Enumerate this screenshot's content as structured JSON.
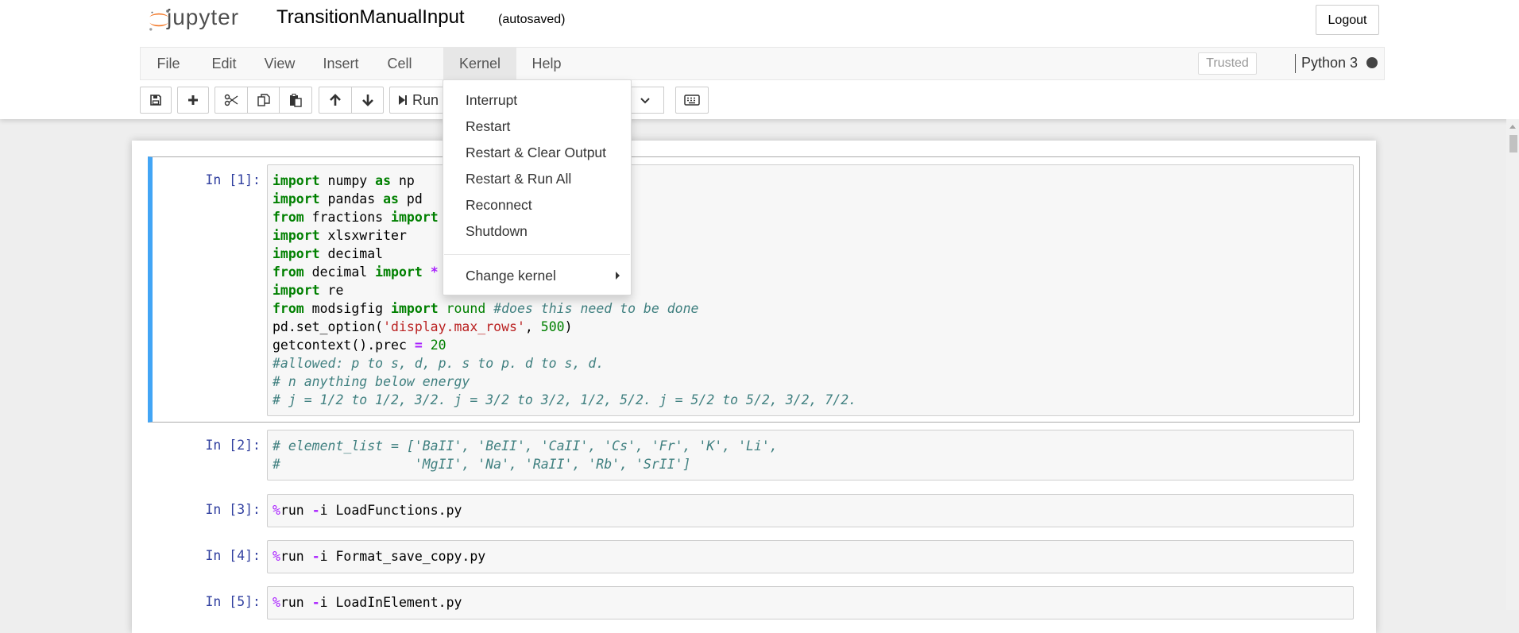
{
  "header": {
    "logo_text": "jupyter",
    "notebook_title": "TransitionManualInput",
    "autosave_status": "(autosaved)",
    "logout_label": "Logout"
  },
  "menubar": {
    "items": [
      "File",
      "Edit",
      "View",
      "Insert",
      "Cell",
      "Kernel",
      "Help"
    ],
    "active": "Kernel",
    "trusted_label": "Trusted",
    "kernel_name": "Python 3"
  },
  "toolbar": {
    "run_label": "Run",
    "buttons": [
      "save-icon",
      "plus-icon",
      "cut-icon",
      "copy-icon",
      "paste-icon",
      "arrow-up-icon",
      "arrow-down-icon",
      "run-icon",
      "chevron-down-icon",
      "keyboard-icon"
    ]
  },
  "kernel_menu": {
    "items": [
      "Interrupt",
      "Restart",
      "Restart & Clear Output",
      "Restart & Run All",
      "Reconnect",
      "Shutdown"
    ],
    "change_kernel": "Change kernel"
  },
  "cells": [
    {
      "prompt": "In [1]:",
      "lines": [
        "import numpy as np",
        "import pandas as pd",
        "from fractions import",
        "import xlsxwriter",
        "import decimal",
        "from decimal import *",
        "import re",
        "from modsigfig import round #does this need to be done",
        "pd.set_option('display.max_rows', 500)",
        "getcontext().prec = 20",
        "#allowed: p to s, d, p. s to p. d to s, d.",
        "# n anything below energy",
        "# j = 1/2 to 1/2, 3/2. j = 3/2 to 3/2, 1/2, 5/2. j = 5/2 to 5/2, 3/2, 7/2."
      ]
    },
    {
      "prompt": "In [2]:",
      "lines": [
        "# element_list = ['BaII', 'BeII', 'CaII', 'Cs', 'Fr', 'K', 'Li',",
        "#                 'MgII', 'Na', 'RaII', 'Rb', 'SrII']"
      ]
    },
    {
      "prompt": "In [3]:",
      "lines": [
        "%run -i LoadFunctions.py"
      ]
    },
    {
      "prompt": "In [4]:",
      "lines": [
        "%run -i Format_save_copy.py"
      ]
    },
    {
      "prompt": "In [5]:",
      "lines": [
        "%run -i LoadInElement.py"
      ]
    }
  ],
  "colors": {
    "accent_selected_cell": "#42a5f5",
    "prompt": "#303f9f",
    "keyword": "#008000",
    "comment": "#408080",
    "string": "#ba2121",
    "magic": "#aa22ff"
  }
}
